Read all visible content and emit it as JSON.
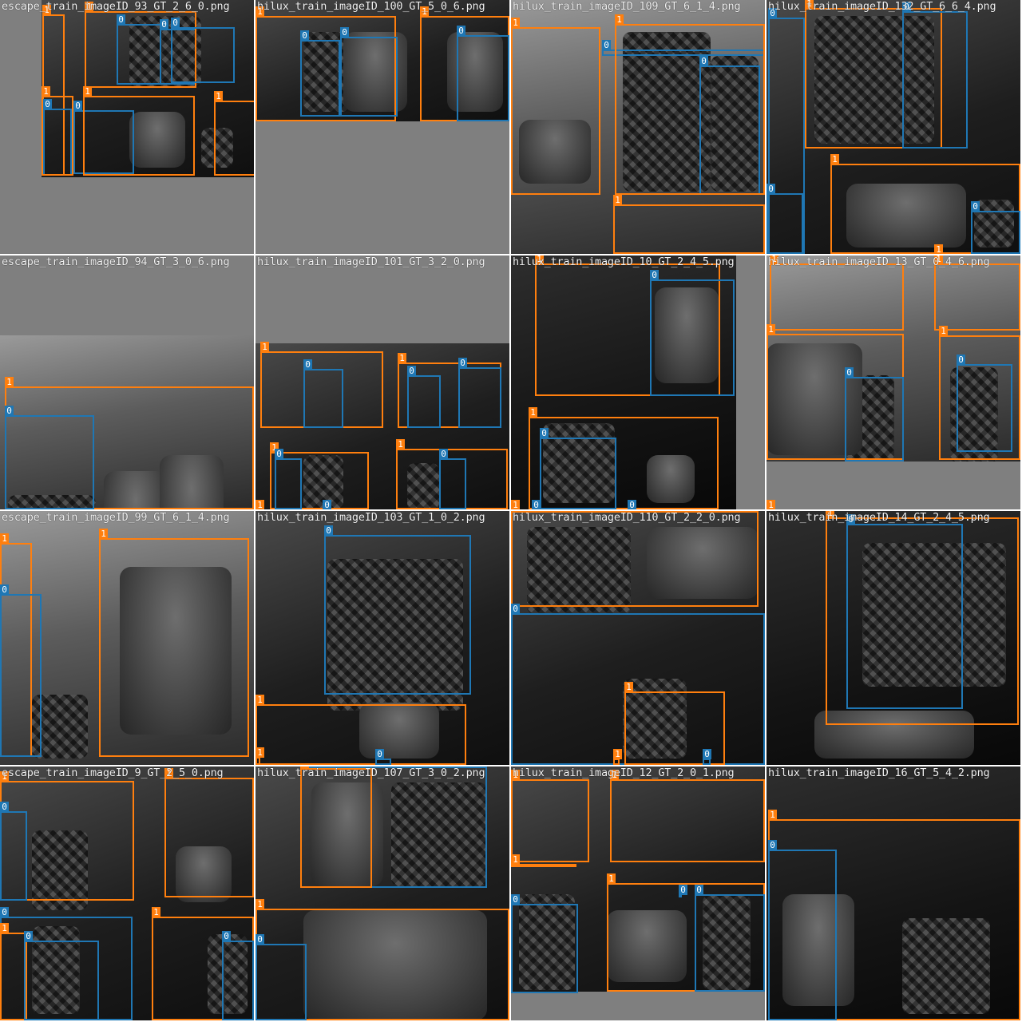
{
  "class_colors": {
    "0": "#1f77b4",
    "1": "#ff7f0e"
  },
  "tiles": [
    {
      "filename": "escape_train_imageID_93_GT_2_6_0.png",
      "boxes": [
        "1",
        "0",
        "0",
        "1",
        "0",
        "1",
        "0",
        "1",
        "0",
        "1"
      ]
    },
    {
      "filename": "hilux_train_imageID_100_GT_5_0_6.png",
      "boxes": [
        "1",
        "0",
        "0",
        "1",
        "0"
      ]
    },
    {
      "filename": "hilux_train_imageID_109_GT_6_1_4.png",
      "boxes": [
        "0",
        "1",
        "0",
        "1",
        "1"
      ]
    },
    {
      "filename": "hilux_train_imageID_132_GT_6_6_4.png",
      "boxes": [
        "0",
        "1",
        "0",
        "1",
        "0",
        "0",
        "1"
      ]
    },
    {
      "filename": "escape_train_imageID_94_GT_3_0_6.png",
      "boxes": [
        "1",
        "0"
      ]
    },
    {
      "filename": "hilux_train_imageID_101_GT_3_2_0.png",
      "boxes": [
        "1",
        "0",
        "1",
        "0",
        "0",
        "1",
        "0",
        "1",
        "0",
        "1",
        "0"
      ]
    },
    {
      "filename": "hilux_train_imageID_10_GT_2_4_5.png",
      "boxes": [
        "1",
        "0",
        "1",
        "0",
        "1",
        "0",
        "0"
      ]
    },
    {
      "filename": "hilux_train_imageID_13_GT_0_4_6.png",
      "boxes": [
        "1",
        "1",
        "1",
        "0",
        "1",
        "0",
        "1"
      ]
    },
    {
      "filename": "escape_train_imageID_99_GT_6_1_4.png",
      "boxes": [
        "1",
        "0",
        "1"
      ]
    },
    {
      "filename": "hilux_train_imageID_103_GT_1_0_2.png",
      "boxes": [
        "0",
        "1",
        "1",
        "0"
      ]
    },
    {
      "filename": "hilux_train_imageID_110_GT_2_2_0.png",
      "boxes": [
        "1",
        "0",
        "1",
        "1",
        "0"
      ]
    },
    {
      "filename": "hilux_train_imageID_14_GT_2_4_5.png",
      "boxes": [
        "1",
        "0"
      ]
    },
    {
      "filename": "escape_train_imageID_9_GT_2_5_0.png",
      "boxes": [
        "1",
        "0",
        "1",
        "0",
        "1",
        "0",
        "1",
        "0"
      ]
    },
    {
      "filename": "hilux_train_imageID_107_GT_3_0_2.png",
      "boxes": [
        "0",
        "1",
        "1",
        "0"
      ]
    },
    {
      "filename": "hilux_train_imageID_12_GT_2_0_1.png",
      "boxes": [
        "1",
        "1",
        "0",
        "1",
        "0",
        "1",
        "0"
      ]
    },
    {
      "filename": "hilux_train_imageID_16_GT_5_4_2.png",
      "boxes": [
        "1",
        "0"
      ]
    }
  ]
}
